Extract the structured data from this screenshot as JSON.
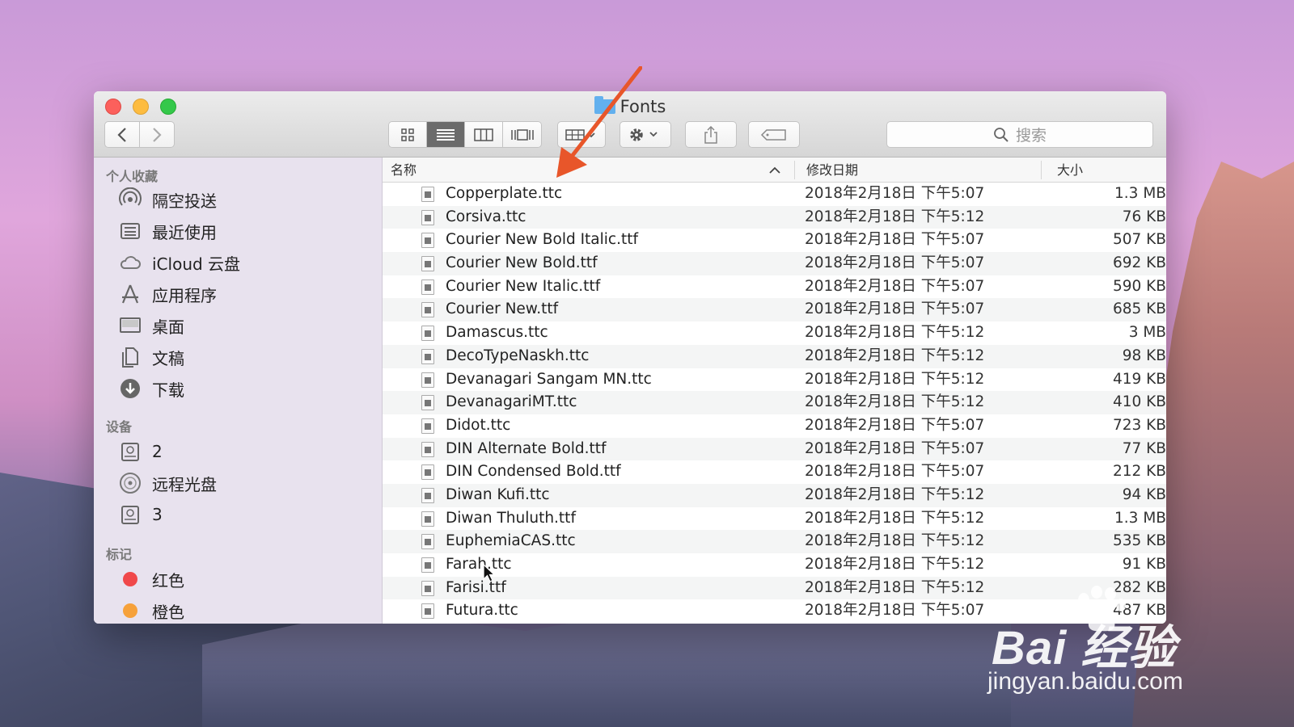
{
  "window": {
    "title": "Fonts",
    "search_placeholder": "搜索"
  },
  "sidebar": {
    "sections": [
      {
        "heading": "个人收藏",
        "items": [
          {
            "label": "隔空投送",
            "icon": "airdrop-icon"
          },
          {
            "label": "最近使用",
            "icon": "recents-icon"
          },
          {
            "label": "iCloud 云盘",
            "icon": "icloud-icon"
          },
          {
            "label": "应用程序",
            "icon": "applications-icon"
          },
          {
            "label": "桌面",
            "icon": "desktop-icon"
          },
          {
            "label": "文稿",
            "icon": "documents-icon"
          },
          {
            "label": "下载",
            "icon": "downloads-icon"
          }
        ]
      },
      {
        "heading": "设备",
        "items": [
          {
            "label": "2",
            "icon": "disk-icon"
          },
          {
            "label": "远程光盘",
            "icon": "remote-disc-icon"
          },
          {
            "label": "3",
            "icon": "disk-icon"
          }
        ]
      },
      {
        "heading": "标记",
        "items": [
          {
            "label": "红色",
            "color": "#f0484a"
          },
          {
            "label": "橙色",
            "color": "#f6a13a"
          }
        ]
      }
    ]
  },
  "columns": {
    "name": "名称",
    "date": "修改日期",
    "size": "大小"
  },
  "files": [
    {
      "name": "Copperplate.ttc",
      "date": "2018年2月18日 下午5:07",
      "size": "1.3 MB"
    },
    {
      "name": "Corsiva.ttc",
      "date": "2018年2月18日 下午5:12",
      "size": "76 KB"
    },
    {
      "name": "Courier New Bold Italic.ttf",
      "date": "2018年2月18日 下午5:07",
      "size": "507 KB"
    },
    {
      "name": "Courier New Bold.ttf",
      "date": "2018年2月18日 下午5:07",
      "size": "692 KB"
    },
    {
      "name": "Courier New Italic.ttf",
      "date": "2018年2月18日 下午5:07",
      "size": "590 KB"
    },
    {
      "name": "Courier New.ttf",
      "date": "2018年2月18日 下午5:07",
      "size": "685 KB"
    },
    {
      "name": "Damascus.ttc",
      "date": "2018年2月18日 下午5:12",
      "size": "3 MB"
    },
    {
      "name": "DecoTypeNaskh.ttc",
      "date": "2018年2月18日 下午5:12",
      "size": "98 KB"
    },
    {
      "name": "Devanagari Sangam MN.ttc",
      "date": "2018年2月18日 下午5:12",
      "size": "419 KB"
    },
    {
      "name": "DevanagariMT.ttc",
      "date": "2018年2月18日 下午5:12",
      "size": "410 KB"
    },
    {
      "name": "Didot.ttc",
      "date": "2018年2月18日 下午5:07",
      "size": "723 KB"
    },
    {
      "name": "DIN Alternate Bold.ttf",
      "date": "2018年2月18日 下午5:07",
      "size": "77 KB"
    },
    {
      "name": "DIN Condensed Bold.ttf",
      "date": "2018年2月18日 下午5:07",
      "size": "212 KB"
    },
    {
      "name": "Diwan Kufi.ttc",
      "date": "2018年2月18日 下午5:12",
      "size": "94 KB"
    },
    {
      "name": "Diwan Thuluth.ttf",
      "date": "2018年2月18日 下午5:12",
      "size": "1.3 MB"
    },
    {
      "name": "EuphemiaCAS.ttc",
      "date": "2018年2月18日 下午5:12",
      "size": "535 KB"
    },
    {
      "name": "Farah.ttc",
      "date": "2018年2月18日 下午5:12",
      "size": "91 KB"
    },
    {
      "name": "Farisi.ttf",
      "date": "2018年2月18日 下午5:12",
      "size": "282 KB"
    },
    {
      "name": "Futura.ttc",
      "date": "2018年2月18日 下午5:07",
      "size": "487 KB"
    }
  ],
  "watermark": {
    "brand": "Bai  经验",
    "url": "jingyan.baidu.com"
  },
  "colors": {
    "close": "#fc605c",
    "minimize": "#fdbc40",
    "maximize": "#34c84a",
    "annotation_arrow": "#e8562a"
  }
}
